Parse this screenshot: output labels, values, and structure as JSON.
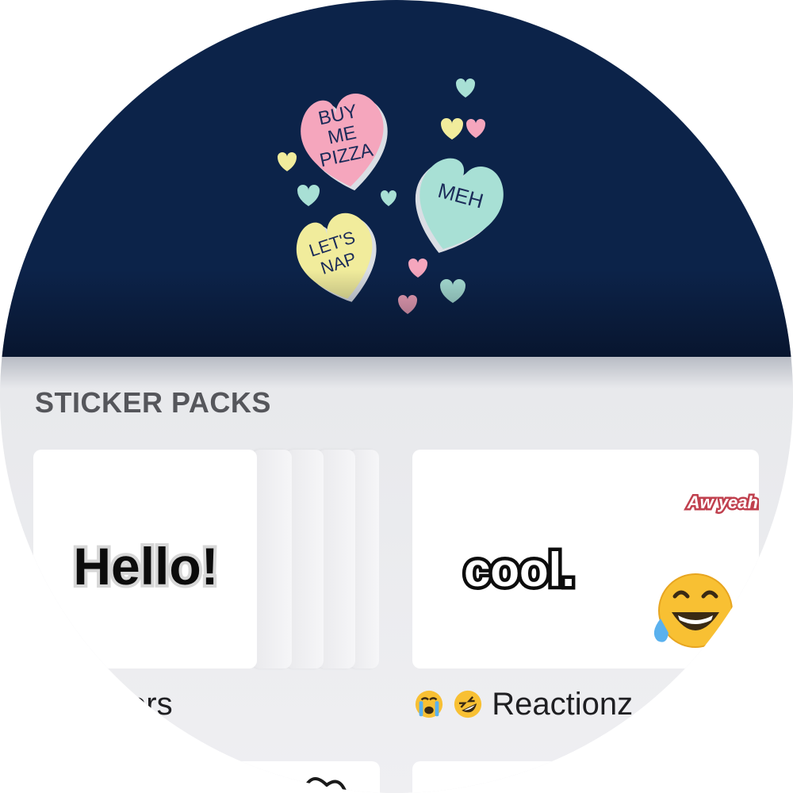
{
  "banner": {
    "hearts": [
      {
        "lines": [
          "BUY",
          "ME",
          "PIZZA"
        ]
      },
      {
        "lines": [
          "MEH"
        ]
      },
      {
        "lines": [
          "LET'S",
          "NAP"
        ]
      }
    ]
  },
  "section": {
    "title": "STICKER PACKS"
  },
  "packs": [
    {
      "name": "kers",
      "preview_text": "Hello!"
    },
    {
      "name": "Reactionz",
      "preview_text": "cool.",
      "secondary_text": "Aw yeah!",
      "emoji": "laughing-crying-emoji"
    }
  ],
  "colors": {
    "banner_bg": "#0c2349",
    "heart_pink": "#f5a6bd",
    "heart_teal": "#a8e0d5",
    "heart_yellow": "#f1ec9c",
    "heart_text": "#1b2b59"
  }
}
